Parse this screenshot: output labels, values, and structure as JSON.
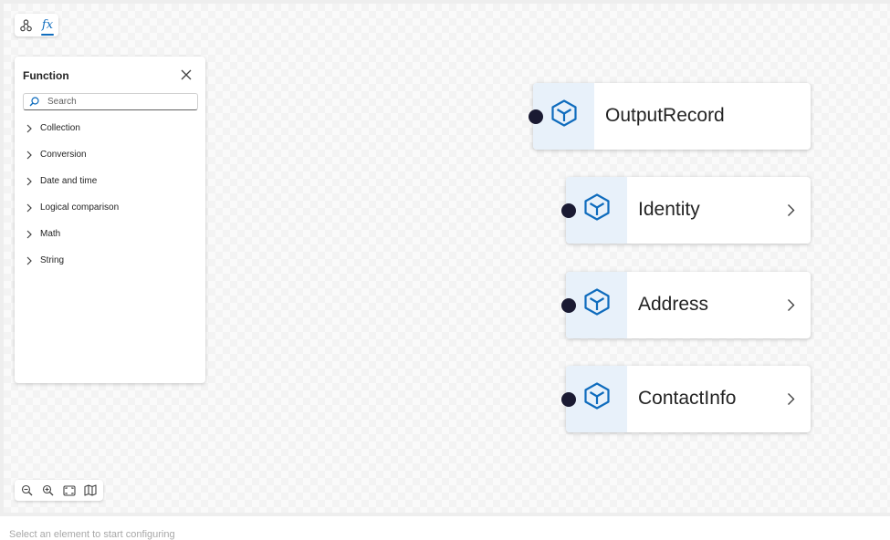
{
  "toolbar": {
    "tools": [
      {
        "icon": "schema-icon"
      },
      {
        "label": "fx",
        "icon": "function-icon",
        "active": true
      }
    ]
  },
  "function_panel": {
    "title": "Function",
    "search": {
      "placeholder": "Search",
      "value": ""
    },
    "categories": [
      {
        "label": "Collection"
      },
      {
        "label": "Conversion"
      },
      {
        "label": "Date and time"
      },
      {
        "label": "Logical comparison"
      },
      {
        "label": "Math"
      },
      {
        "label": "String"
      }
    ]
  },
  "zoom_controls": {
    "icons": [
      "zoom-out-icon",
      "zoom-in-icon",
      "fit-to-screen-icon",
      "minimap-icon"
    ]
  },
  "nodes": [
    {
      "label": "OutputRecord",
      "icon": "cube-icon",
      "expandable": false
    },
    {
      "label": "Identity",
      "icon": "cube-icon",
      "expandable": true
    },
    {
      "label": "Address",
      "icon": "cube-icon",
      "expandable": true
    },
    {
      "label": "ContactInfo",
      "icon": "cube-icon",
      "expandable": true
    }
  ],
  "status_bar": {
    "message": "Select an element to start configuring"
  },
  "colors": {
    "accent": "#0f6cbd",
    "node_icon_bg": "#e8f1fa",
    "connector_dot": "#1a1a32",
    "status_text": "#a8a8a8"
  }
}
